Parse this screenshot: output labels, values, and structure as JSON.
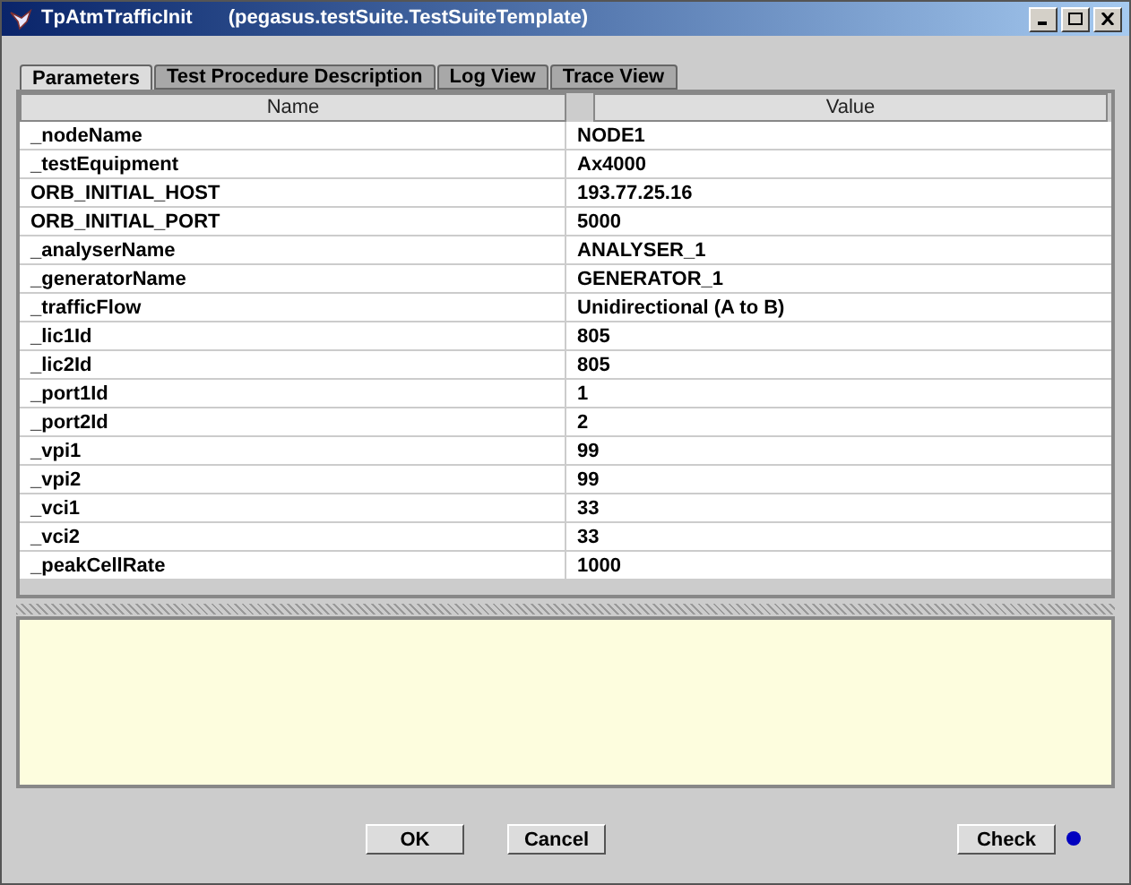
{
  "window": {
    "title": "TpAtmTrafficInit",
    "subtitle": "(pegasus.testSuite.TestSuiteTemplate)"
  },
  "tabs": [
    {
      "label": "Parameters",
      "selected": true
    },
    {
      "label": "Test Procedure Description",
      "selected": false
    },
    {
      "label": "Log View",
      "selected": false
    },
    {
      "label": "Trace View",
      "selected": false
    }
  ],
  "table": {
    "columns": [
      "Name",
      "Value"
    ],
    "rows": [
      [
        "_nodeName",
        "NODE1"
      ],
      [
        "_testEquipment",
        "Ax4000"
      ],
      [
        "ORB_INITIAL_HOST",
        "193.77.25.16"
      ],
      [
        "ORB_INITIAL_PORT",
        "5000"
      ],
      [
        "_analyserName",
        "ANALYSER_1"
      ],
      [
        "_generatorName",
        "GENERATOR_1"
      ],
      [
        "_trafficFlow",
        "Unidirectional (A to B)"
      ],
      [
        "_lic1Id",
        "805"
      ],
      [
        "_lic2Id",
        "805"
      ],
      [
        "_port1Id",
        "1"
      ],
      [
        "_port2Id",
        "2"
      ],
      [
        "_vpi1",
        "99"
      ],
      [
        "_vpi2",
        "99"
      ],
      [
        "_vci1",
        "33"
      ],
      [
        "_vci2",
        "33"
      ],
      [
        "_peakCellRate",
        "1000"
      ]
    ]
  },
  "buttons": [
    "OK",
    "Cancel"
  ],
  "check_button": "Check",
  "status_indicator": {
    "color": "#0000c0"
  }
}
